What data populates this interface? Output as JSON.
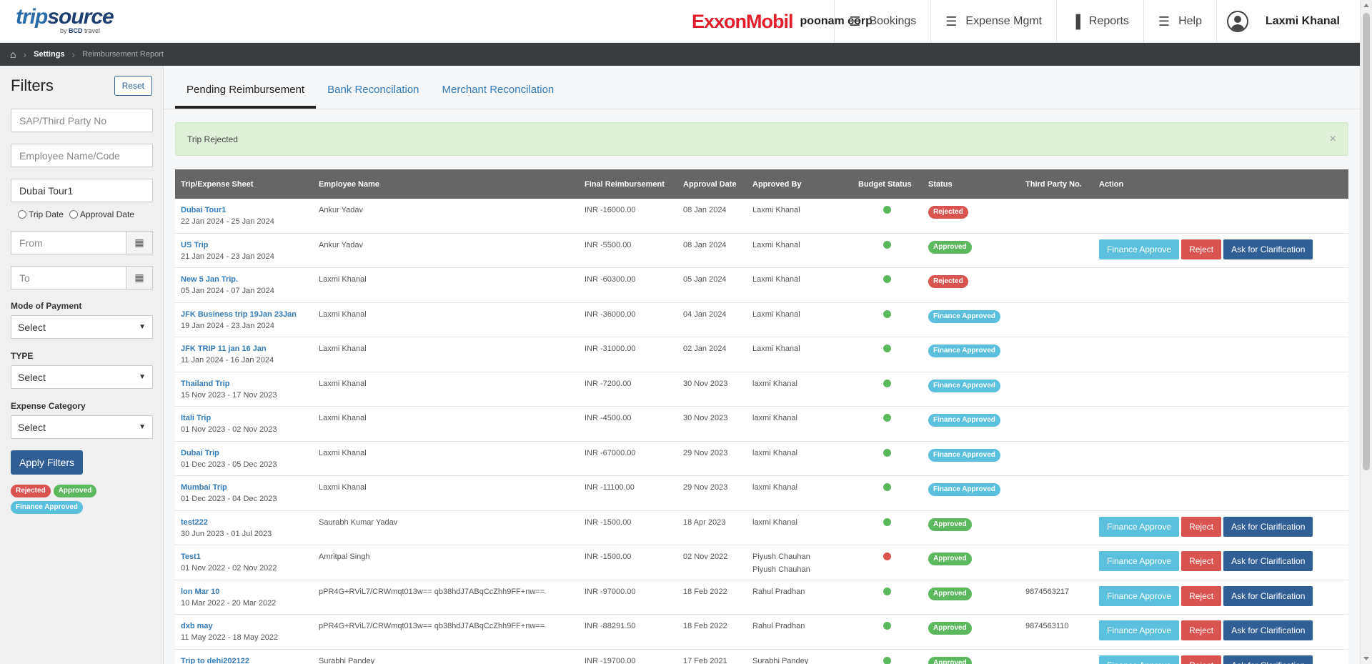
{
  "header": {
    "logo_main": "trip",
    "logo_accent": "source",
    "logo_sub_prefix": "by",
    "logo_sub_brand": "BCD",
    "logo_sub_suffix": "travel",
    "client_logo": "ExxonMobil",
    "company": "poonam corp",
    "nav": [
      {
        "label": "Bookings",
        "icon": "menu-icon"
      },
      {
        "label": "Expense Mgmt",
        "icon": "menu-icon"
      },
      {
        "label": "Reports",
        "icon": "bar-chart-icon"
      },
      {
        "label": "Help",
        "icon": "menu-icon"
      }
    ],
    "user": "Laxmi Khanal"
  },
  "breadcrumb": {
    "items": [
      "Settings",
      "Reimbursement Report"
    ]
  },
  "filters": {
    "title": "Filters",
    "reset": "Reset",
    "sap_placeholder": "SAP/Third Party No",
    "employee_placeholder": "Employee Name/Code",
    "trip_value": "Dubai Tour1",
    "radio_trip": "Trip Date",
    "radio_approval": "Approval Date",
    "from_placeholder": "From",
    "to_placeholder": "To",
    "mode_label": "Mode of Payment",
    "mode_value": "Select",
    "type_label": "TYPE",
    "type_value": "Select",
    "category_label": "Expense Category",
    "category_value": "Select",
    "apply": "Apply Filters",
    "legend": [
      "Rejected",
      "Approved",
      "Finance Approved"
    ]
  },
  "tabs": [
    "Pending Reimbursement",
    "Bank Reconcilation",
    "Merchant Reconcilation"
  ],
  "alert": {
    "text": "Trip Rejected",
    "close": "×"
  },
  "table": {
    "headers": [
      "Trip/Expense Sheet",
      "Employee Name",
      "Final Reimbursement",
      "Approval Date",
      "Approved By",
      "Budget Status",
      "Status",
      "Third Party No.",
      "Action"
    ],
    "action_labels": {
      "finance": "Finance Approve",
      "reject": "Reject",
      "clarify": "Ask for Clarification"
    },
    "rows": [
      {
        "trip": "Dubai Tour1",
        "range": "22 Jan 2024 - 25 Jan 2024",
        "employee": "Ankur Yadav",
        "amount": "INR -16000.00",
        "date": "08 Jan 2024",
        "by": "Laxmi Khanal",
        "by2": "",
        "budget": "#5cb85c",
        "status": "Rejected",
        "status_class": "rej",
        "third": "",
        "actions": false
      },
      {
        "trip": "US Trip",
        "range": "21 Jan 2024 - 23 Jan 2024",
        "employee": "Ankur Yadav",
        "amount": "INR -5500.00",
        "date": "08 Jan 2024",
        "by": "Laxmi Khanal",
        "by2": "",
        "budget": "#5cb85c",
        "status": "Approved",
        "status_class": "app",
        "third": "",
        "actions": true
      },
      {
        "trip": "New 5 Jan Trip.",
        "range": "05 Jan 2024 - 07 Jan 2024",
        "employee": "Laxmi Khanal",
        "amount": "INR -60300.00",
        "date": "05 Jan 2024",
        "by": "Laxmi Khanal",
        "by2": "",
        "budget": "#5cb85c",
        "status": "Rejected",
        "status_class": "rej",
        "third": "",
        "actions": false
      },
      {
        "trip": "JFK Business trip 19Jan 23Jan",
        "range": "19 Jan 2024 - 23 Jan 2024",
        "employee": "Laxmi Khanal",
        "amount": "INR -36000.00",
        "date": "04 Jan 2024",
        "by": "Laxmi Khanal",
        "by2": "",
        "budget": "#5cb85c",
        "status": "Finance Approved",
        "status_class": "fin",
        "third": "",
        "actions": false
      },
      {
        "trip": "JFK TRIP 11 jan 16 Jan",
        "range": "11 Jan 2024 - 16 Jan 2024",
        "employee": "Laxmi Khanal",
        "amount": "INR -31000.00",
        "date": "02 Jan 2024",
        "by": "Laxmi Khanal",
        "by2": "",
        "budget": "#5cb85c",
        "status": "Finance Approved",
        "status_class": "fin",
        "third": "",
        "actions": false
      },
      {
        "trip": "Thailand Trip",
        "range": "15 Nov 2023 - 17 Nov 2023",
        "employee": "Laxmi Khanal",
        "amount": "INR -7200.00",
        "date": "30 Nov 2023",
        "by": "laxmi Khanal",
        "by2": "",
        "budget": "#5cb85c",
        "status": "Finance Approved",
        "status_class": "fin",
        "third": "",
        "actions": false
      },
      {
        "trip": "Itali Trip",
        "range": "01 Nov 2023 - 02 Nov 2023",
        "employee": "Laxmi Khanal",
        "amount": "INR -4500.00",
        "date": "30 Nov 2023",
        "by": "laxmi Khanal",
        "by2": "",
        "budget": "#5cb85c",
        "status": "Finance Approved",
        "status_class": "fin",
        "third": "",
        "actions": false
      },
      {
        "trip": "Dubai Trip",
        "range": "01 Dec 2023 - 05 Dec 2023",
        "employee": "Laxmi Khanal",
        "amount": "INR -67000.00",
        "date": "29 Nov 2023",
        "by": "laxmi Khanal",
        "by2": "",
        "budget": "#5cb85c",
        "status": "Finance Approved",
        "status_class": "fin",
        "third": "",
        "actions": false
      },
      {
        "trip": "Mumbai Trip",
        "range": "01 Dec 2023 - 04 Dec 2023",
        "employee": "Laxmi Khanal",
        "amount": "INR -11100.00",
        "date": "29 Nov 2023",
        "by": "laxmi Khanal",
        "by2": "",
        "budget": "#5cb85c",
        "status": "Finance Approved",
        "status_class": "fin",
        "third": "",
        "actions": false
      },
      {
        "trip": "test222",
        "range": "30 Jun 2023 - 01 Jul 2023",
        "employee": "Saurabh Kumar Yadav",
        "amount": "INR -1500.00",
        "date": "18 Apr 2023",
        "by": "laxmi Khanal",
        "by2": "",
        "budget": "#5cb85c",
        "status": "Approved",
        "status_class": "app",
        "third": "",
        "actions": true
      },
      {
        "trip": "Test1",
        "range": "01 Nov 2022 - 02 Nov 2022",
        "employee": "Amritpal Singh",
        "amount": "INR -1500.00",
        "date": "02 Nov 2022",
        "by": "Piyush Chauhan",
        "by2": "Piyush Chauhan",
        "budget": "#d9534f",
        "status": "Approved",
        "status_class": "app",
        "third": "",
        "actions": true
      },
      {
        "trip": "lon Mar 10",
        "range": "10 Mar 2022 - 20 Mar 2022",
        "employee": "pPR4G+RViL7/CRWmqt013w== qb38hdJ7ABqCcZhh9FF+nw==",
        "amount": "INR -97000.00",
        "date": "18 Feb 2022",
        "by": "Rahul Pradhan",
        "by2": "",
        "budget": "#5cb85c",
        "status": "Approved",
        "status_class": "app",
        "third": "9874563217",
        "actions": true
      },
      {
        "trip": "dxb may",
        "range": "11 May 2022 - 18 May 2022",
        "employee": "pPR4G+RViL7/CRWmqt013w== qb38hdJ7ABqCcZhh9FF+nw==",
        "amount": "INR -88291.50",
        "date": "18 Feb 2022",
        "by": "Rahul Pradhan",
        "by2": "",
        "budget": "#5cb85c",
        "status": "Approved",
        "status_class": "app",
        "third": "9874563110",
        "actions": true
      },
      {
        "trip": "Trip to dehi202122",
        "range": "",
        "employee": "Surabhi Pandey",
        "amount": "INR -19700.00",
        "date": "17 Feb 2021",
        "by": "Surabhi Pandey",
        "by2": "",
        "budget": "#5cb85c",
        "status": "Approved",
        "status_class": "app",
        "third": "",
        "actions": true
      }
    ]
  }
}
